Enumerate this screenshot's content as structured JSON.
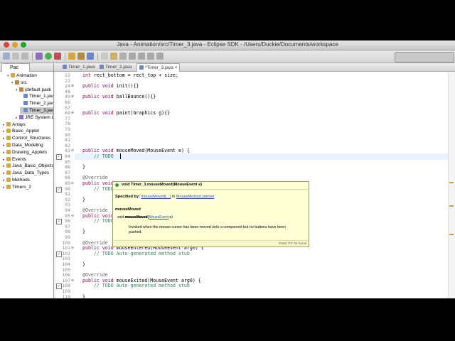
{
  "window": {
    "title": "Java - Animation/src/Timer_3.java - Eclipse SDK - /Users/Duckie/Documents/workspace"
  },
  "explorer": {
    "tab_label": "Pac",
    "items": [
      {
        "label": "Animation",
        "icon": "project-icon"
      },
      {
        "label": "src",
        "icon": "source-folder-icon"
      },
      {
        "label": "(default pack",
        "icon": "package-icon"
      },
      {
        "label": "Timer_1.java",
        "icon": "java-file-icon"
      },
      {
        "label": "Timer_2.java",
        "icon": "java-file-icon"
      },
      {
        "label": "Timer_3.java",
        "icon": "java-file-icon"
      },
      {
        "label": "JRE System Libr",
        "icon": "library-icon"
      },
      {
        "label": "Arrays",
        "icon": "project-icon"
      },
      {
        "label": "Basic_Applet",
        "icon": "project-icon"
      },
      {
        "label": "Control_Structures",
        "icon": "project-icon"
      },
      {
        "label": "Data_Modeling",
        "icon": "project-icon"
      },
      {
        "label": "Drawing_Applets",
        "icon": "project-icon"
      },
      {
        "label": "Events",
        "icon": "project-icon"
      },
      {
        "label": "Java_Basic_Objects",
        "icon": "project-icon"
      },
      {
        "label": "Java_Data_Types",
        "icon": "project-icon"
      },
      {
        "label": "Methods",
        "icon": "project-icon"
      },
      {
        "label": "Timers_2",
        "icon": "project-icon"
      }
    ]
  },
  "editor": {
    "tabs": [
      {
        "label": "Timer_1.java"
      },
      {
        "label": "Timer_2.java"
      },
      {
        "label": "*Timer_3.java"
      }
    ],
    "lines": [
      {
        "num": "22",
        "text": "int rect_bottom = rect_top + size;"
      },
      {
        "num": "23",
        "text": ""
      },
      {
        "num": "24",
        "text": "public void init(){}"
      },
      {
        "num": "48",
        "text": ""
      },
      {
        "num": "49",
        "text": "public void ballBounce(){}"
      },
      {
        "num": "66",
        "text": ""
      },
      {
        "num": "67",
        "text": ""
      },
      {
        "num": "68",
        "text": "public void paint(Graphics g){}"
      },
      {
        "num": "77",
        "text": ""
      },
      {
        "num": "78",
        "text": ""
      },
      {
        "num": "79",
        "text": ""
      },
      {
        "num": "80",
        "text": ""
      },
      {
        "num": "81",
        "text": ""
      },
      {
        "num": "82",
        "text": ""
      },
      {
        "num": "83",
        "text": "public void mouseMoved(MouseEvent e) {"
      },
      {
        "num": "84",
        "text": "    // TODO"
      },
      {
        "num": "85",
        "text": ""
      },
      {
        "num": "86",
        "text": "}"
      },
      {
        "num": "87",
        "text": ""
      },
      {
        "num": "88",
        "text": "@Override"
      },
      {
        "num": "89",
        "text": "public void"
      },
      {
        "num": "90",
        "text": "    // TODO"
      },
      {
        "num": "91",
        "text": ""
      },
      {
        "num": "92",
        "text": "}"
      },
      {
        "num": "93",
        "text": ""
      },
      {
        "num": "94",
        "text": "@Override"
      },
      {
        "num": "95",
        "text": "public void"
      },
      {
        "num": "96",
        "text": "    // TODO Auto-generated method stub"
      },
      {
        "num": "97",
        "text": ""
      },
      {
        "num": "98",
        "text": "}"
      },
      {
        "num": "99",
        "text": ""
      },
      {
        "num": "100",
        "text": "@Override"
      },
      {
        "num": "101",
        "text": "public void mouseEntered(MouseEvent arg0) {"
      },
      {
        "num": "102",
        "text": "    // TODO Auto-generated method stub"
      },
      {
        "num": "103",
        "text": ""
      },
      {
        "num": "104",
        "text": "}"
      },
      {
        "num": "105",
        "text": ""
      },
      {
        "num": "106",
        "text": "@Override"
      },
      {
        "num": "107",
        "text": "public void mouseExited(MouseEvent arg0) {"
      },
      {
        "num": "108",
        "text": "    // TODO Auto-generated method stub"
      },
      {
        "num": "109",
        "text": ""
      },
      {
        "num": "110",
        "text": "}"
      },
      {
        "num": "111",
        "text": ""
      }
    ]
  },
  "popup": {
    "header": "void Timer_3.mouseMoved(MouseEvent e)",
    "specified_by_label": "Specified by:",
    "specified_by_method": "mouseMoved(...)",
    "specified_by_in": "in",
    "specified_by_interface": "MouseMotionListener",
    "section_title": "mouseMoved",
    "signature_prefix": "void",
    "signature_name": "mouseMoved",
    "signature_param_type": "MouseEvent",
    "signature_param": "e)",
    "description_line1": "Invoked when the mouse cursor has been moved onto a component but no buttons have been",
    "description_line2": "pushed.",
    "footer": "Press 'F2' for focus"
  }
}
